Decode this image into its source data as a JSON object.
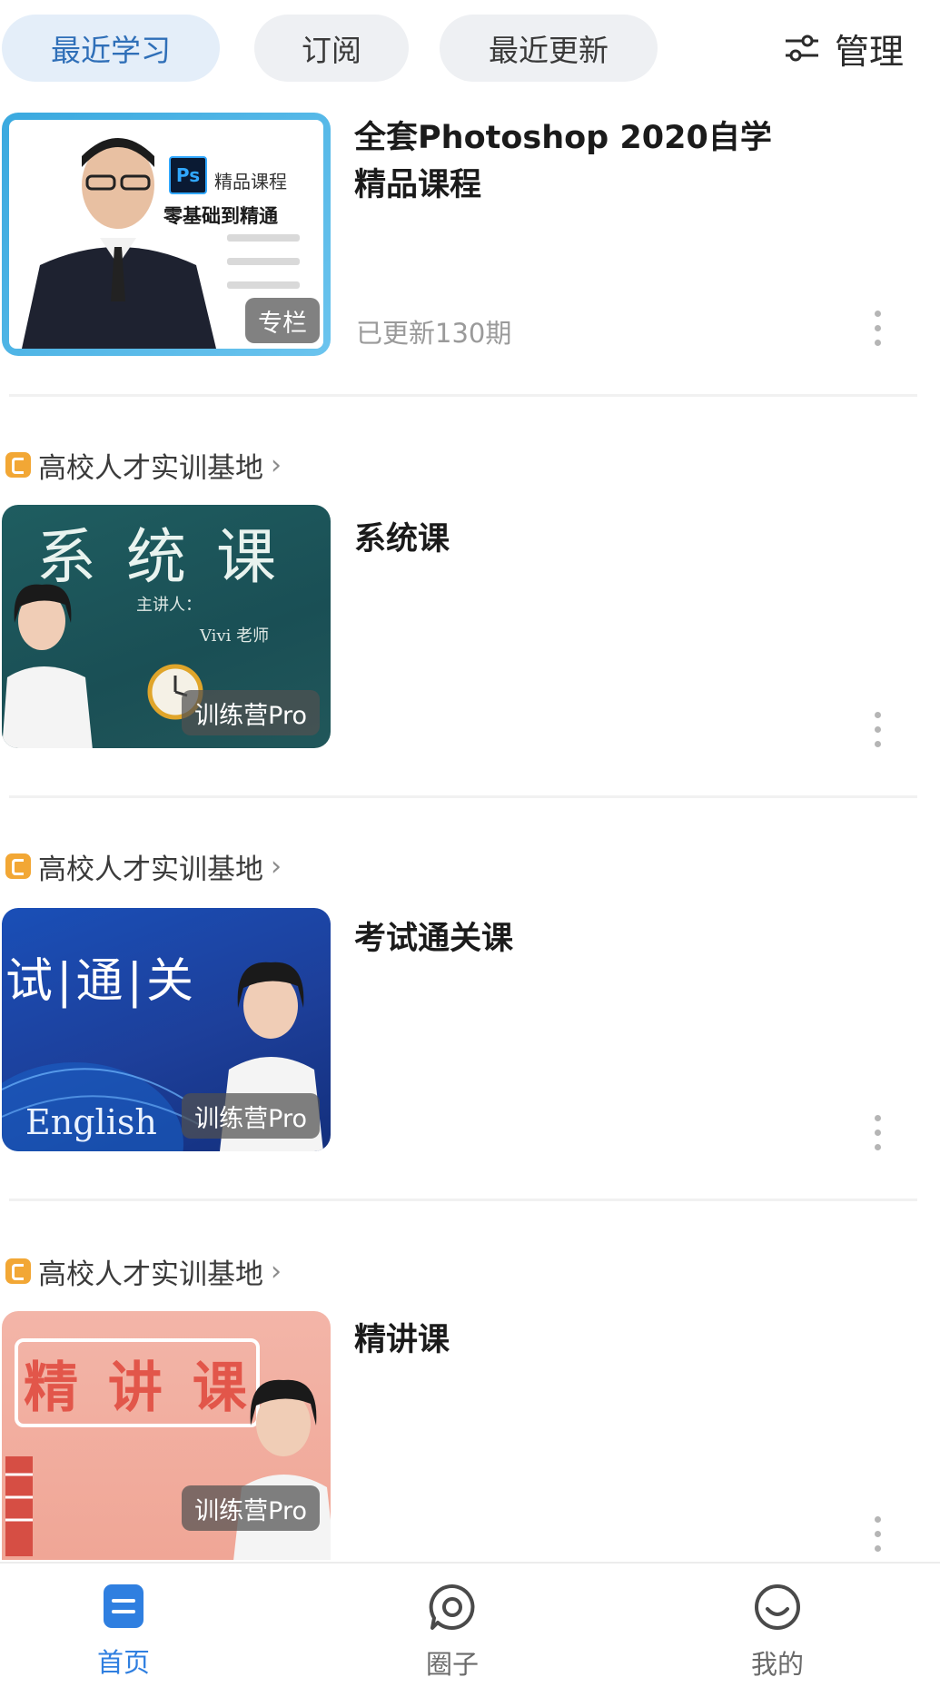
{
  "tabs": [
    {
      "label": "最近学习",
      "active": true
    },
    {
      "label": "订阅",
      "active": false
    },
    {
      "label": "最近更新",
      "active": false
    }
  ],
  "manage_label": "管理",
  "courses": [
    {
      "title": "全套Photoshop 2020自学精品课程",
      "subtitle": "已更新130期",
      "badge": "专栏",
      "source": "",
      "thumb_text": {
        "ps": "Ps",
        "line1": "精品课程",
        "line2": "零基础到精通"
      }
    },
    {
      "title": "系统课",
      "subtitle": "",
      "badge": "训练营Pro",
      "source": "高校人才实训基地",
      "thumb_text": {
        "big": "系 统 课",
        "line1": "主讲人：",
        "line2": "Vivi 老师"
      }
    },
    {
      "title": "考试通关课",
      "subtitle": "",
      "badge": "训练营Pro",
      "source": "高校人才实训基地",
      "thumb_text": {
        "big": "试|通|关",
        "line1": "English"
      }
    },
    {
      "title": "精讲课",
      "subtitle": "",
      "badge": "训练营Pro",
      "source": "高校人才实训基地",
      "thumb_text": {
        "big": "精 讲 课"
      }
    }
  ],
  "bottom_nav": [
    {
      "label": "首页",
      "icon": "home-icon",
      "active": true
    },
    {
      "label": "圈子",
      "icon": "chat-circle-icon",
      "active": false
    },
    {
      "label": "我的",
      "icon": "smile-icon",
      "active": false
    }
  ],
  "colors": {
    "accent": "#2f7fe0",
    "active_tab_text": "#2f6fb8",
    "badge_bg": "#f2a735"
  }
}
